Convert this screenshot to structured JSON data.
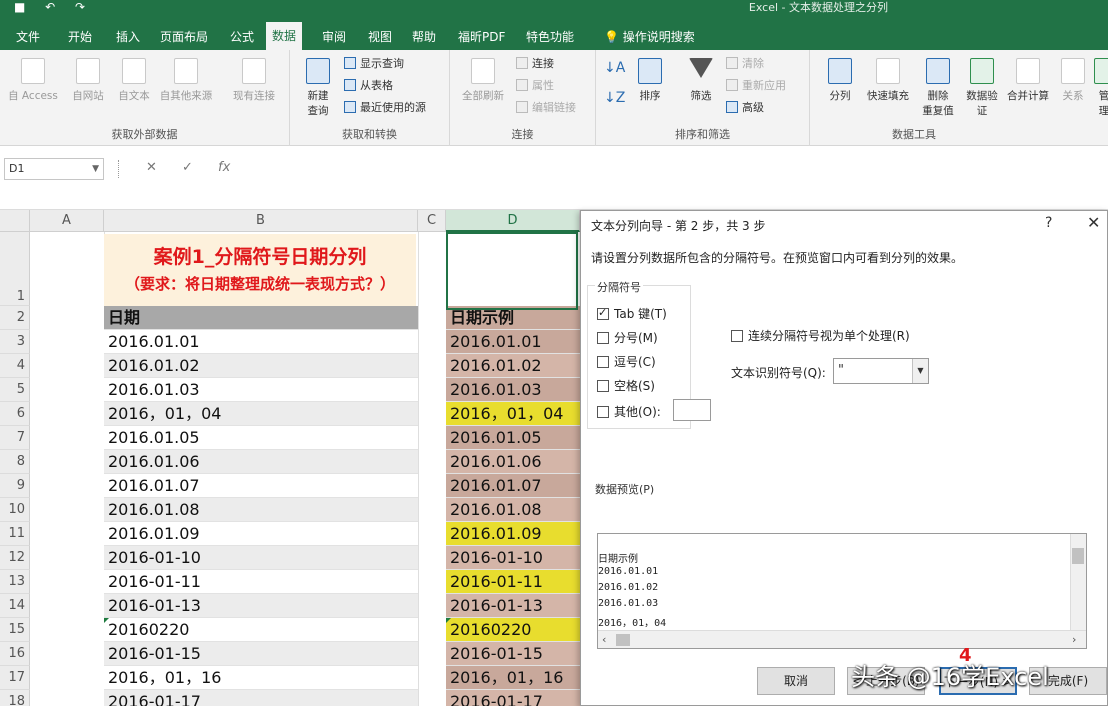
{
  "titlebar": {
    "qat": "■ ↶ ↷",
    "title": "Excel - 文本数据处理之分列"
  },
  "tabs": [
    "文件",
    "开始",
    "插入",
    "页面布局",
    "公式",
    "数据",
    "审阅",
    "视图",
    "帮助",
    "福昕PDF",
    "特色功能",
    "操作说明搜索"
  ],
  "ribbon": {
    "external": {
      "label": "获取外部数据",
      "items": [
        "自 Access",
        "自网站",
        "自文本",
        "自其他来源",
        "现有连接"
      ]
    },
    "transform": {
      "label": "获取和转换",
      "new_query": "新建\n查询",
      "items": [
        "显示查询",
        "从表格",
        "最近使用的源"
      ]
    },
    "connections": {
      "label": "连接",
      "refresh": "全部刷新",
      "items": [
        "连接",
        "属性",
        "编辑链接"
      ]
    },
    "sort": {
      "label": "排序和筛选",
      "sort": "排序",
      "filter": "筛选",
      "items": [
        "清除",
        "重新应用",
        "高级"
      ]
    },
    "tools": {
      "label": "数据工具",
      "items": [
        "分列",
        "快速填充",
        "删除\n重复值",
        "数据验\n证",
        "合并计算",
        "关系",
        "管理"
      ]
    }
  },
  "formula_bar": {
    "name_box": "D1",
    "cancel": "✕",
    "enter": "✓",
    "fx": "fx"
  },
  "grid": {
    "columns": [
      "A",
      "B",
      "C",
      "D"
    ],
    "rows": [
      "1",
      "2",
      "3",
      "4",
      "5",
      "6",
      "7",
      "8",
      "9",
      "10",
      "11",
      "12",
      "13",
      "14",
      "15",
      "16",
      "17",
      "18"
    ],
    "banner_line1": "案例1_分隔符号日期分列",
    "banner_line2": "（要求：将日期整理成统一表现方式？）",
    "b_header": "日期",
    "d_header": "日期示例",
    "b_values": [
      "2016.01.01",
      "2016.01.02",
      "2016.01.03",
      "2016，01，04",
      "2016.01.05",
      "2016.01.06",
      "2016.01.07",
      "2016.01.08",
      "2016.01.09",
      "2016-01-10",
      "2016-01-11",
      "2016-01-13",
      "20160220",
      "2016-01-15",
      "2016，01，16",
      "2016-01-17"
    ],
    "d_values": [
      "2016.01.01",
      "2016.01.02",
      "2016.01.03",
      "2016，01，04",
      "2016.01.05",
      "2016.01.06",
      "2016.01.07",
      "2016.01.08",
      "2016.01.09",
      "2016-01-10",
      "2016-01-11",
      "2016-01-13",
      "20160220",
      "2016-01-15",
      "2016，01，16",
      "2016-01-17"
    ]
  },
  "dialog": {
    "title": "文本分列向导 - 第 2 步，共 3 步",
    "help": "?",
    "close": "✕",
    "description": "请设置分列数据所包含的分隔符号。在预览窗口内可看到分列的效果。",
    "delimiters_title": "分隔符号",
    "delimiters": [
      {
        "label": "Tab 键(T)",
        "checked": true
      },
      {
        "label": "分号(M)",
        "checked": false
      },
      {
        "label": "逗号(C)",
        "checked": false
      },
      {
        "label": "空格(S)",
        "checked": false
      },
      {
        "label": "其他(O):",
        "checked": false
      }
    ],
    "consecutive": "连续分隔符号视为单个处理(R)",
    "qualifier_label": "文本识别符号(Q):",
    "qualifier_value": "\"",
    "preview_label": "数据预览(P)",
    "preview_lines": [
      "日期示例",
      "2016.01.01",
      "2016.01.02",
      "2016.01.03",
      "2016，01，04"
    ],
    "buttons": {
      "cancel": "取消",
      "back": "< 上一步(B)",
      "next": "下一步(N) >",
      "finish": "完成(F)"
    },
    "step_marker": "4"
  },
  "watermark": "头条 @16学Excel",
  "colors": {
    "excel_green": "#217346",
    "banner_red": "#e0181b",
    "highlight_yellow": "#e8dd2e",
    "d_column": "#c8a89b"
  }
}
